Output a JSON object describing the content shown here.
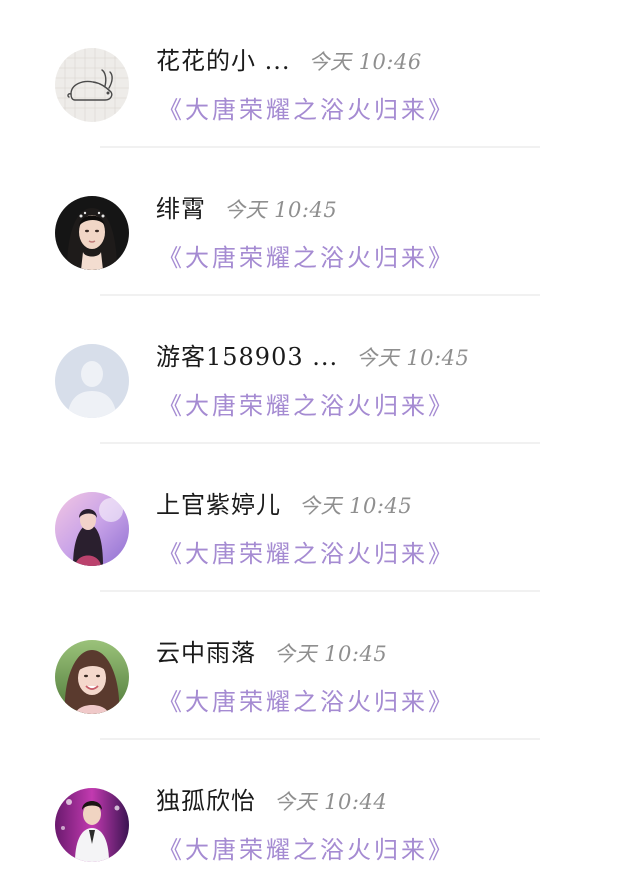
{
  "comments": [
    {
      "name": "花花的小 ...",
      "time": "今天 10:46",
      "text": "《大唐荣耀之浴火归来》",
      "avatar": "rabbit-sketch-avatar"
    },
    {
      "name": "绯霄",
      "time": "今天 10:45",
      "text": "《大唐荣耀之浴火归来》",
      "avatar": "woman-portrait-avatar"
    },
    {
      "name": "游客158903 ...",
      "time": "今天 10:45",
      "text": "《大唐荣耀之浴火归来》",
      "avatar": "default-user-avatar"
    },
    {
      "name": "上官紫婷儿",
      "time": "今天 10:45",
      "text": "《大唐荣耀之浴火归来》",
      "avatar": "pink-photo-avatar"
    },
    {
      "name": "云中雨落",
      "time": "今天 10:45",
      "text": "《大唐荣耀之浴火归来》",
      "avatar": "woman-smiling-avatar"
    },
    {
      "name": "独孤欣怡",
      "time": "今天 10:44",
      "text": "《大唐荣耀之浴火归来》",
      "avatar": "man-white-suit-avatar"
    }
  ],
  "colors": {
    "comment_text": "#a58bd2",
    "name_text": "#1b1b1b",
    "time_text": "#8f8f8f",
    "divider": "#f1f1f1"
  }
}
